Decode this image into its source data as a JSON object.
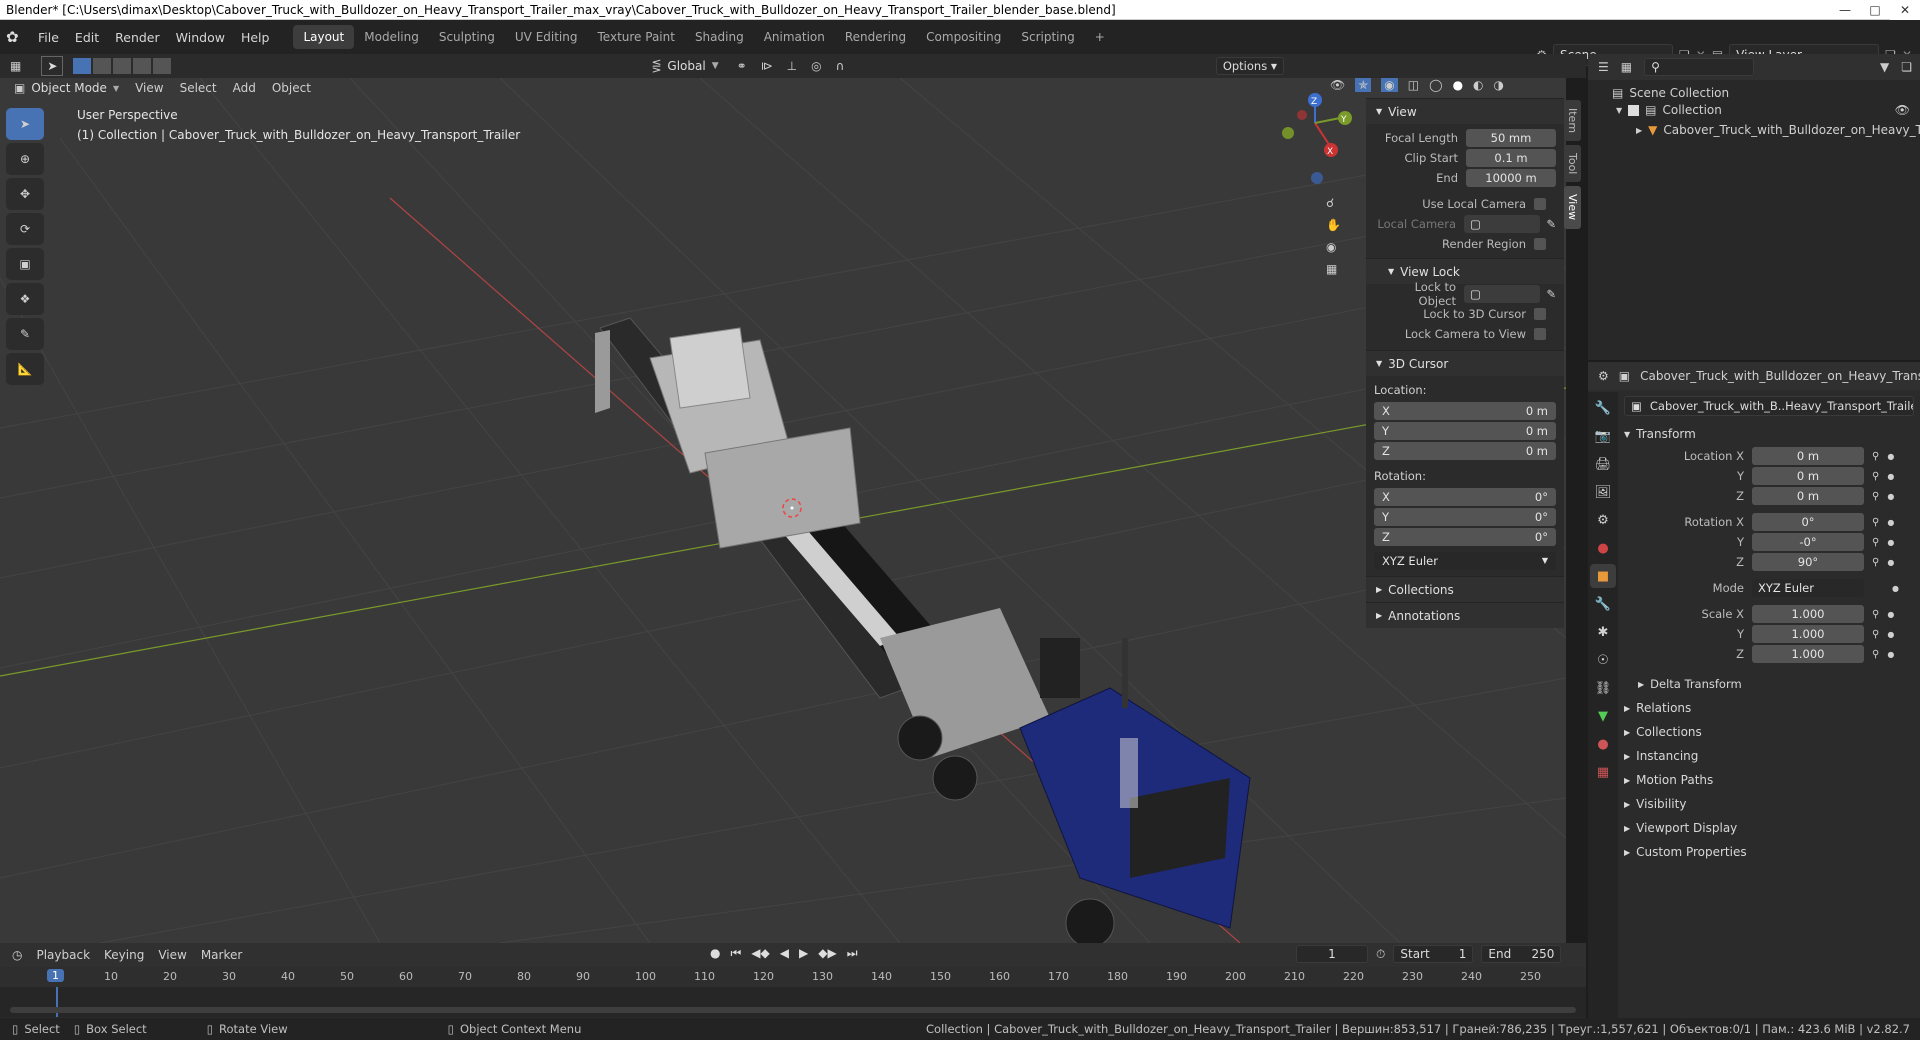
{
  "window": {
    "title": "Blender* [C:\\Users\\dimax\\Desktop\\Cabover_Truck_with_Bulldozer_on_Heavy_Transport_Trailer_max_vray\\Cabover_Truck_with_Bulldozer_on_Heavy_Transport_Trailer_blender_base.blend]"
  },
  "menu": [
    "File",
    "Edit",
    "Render",
    "Window",
    "Help"
  ],
  "workspaces": [
    "Layout",
    "Modeling",
    "Sculpting",
    "UV Editing",
    "Texture Paint",
    "Shading",
    "Animation",
    "Rendering",
    "Compositing",
    "Scripting"
  ],
  "scene": {
    "label": "Scene",
    "view_layer": "View Layer"
  },
  "viewport_header": {
    "mode": "Object Mode",
    "menus": [
      "View",
      "Select",
      "Add",
      "Object"
    ],
    "transform_orientation": "Global",
    "options": "Options"
  },
  "viewport": {
    "perspective": "User Perspective",
    "collection_info": "(1) Collection | Cabover_Truck_with_Bulldozer_on_Heavy_Transport_Trailer",
    "axes": {
      "x": "X",
      "y": "Y",
      "z": "Z"
    }
  },
  "npanel": {
    "tabs": [
      "Item",
      "Tool",
      "View"
    ],
    "view": {
      "header": "View",
      "focal_length_label": "Focal Length",
      "focal_length": "50 mm",
      "clip_start_label": "Clip Start",
      "clip_start": "0.1 m",
      "end_label": "End",
      "end": "10000 m",
      "use_local_camera": "Use Local Camera",
      "local_camera": "Local Camera",
      "render_region": "Render Region"
    },
    "view_lock": {
      "header": "View Lock",
      "lock_to_object": "Lock to Object",
      "lock_to_cursor": "Lock to 3D Cursor",
      "lock_camera": "Lock Camera to View"
    },
    "cursor": {
      "header": "3D Cursor",
      "location_label": "Location:",
      "rotation_label": "Rotation:",
      "loc": [
        {
          "axis": "X",
          "value": "0 m"
        },
        {
          "axis": "Y",
          "value": "0 m"
        },
        {
          "axis": "Z",
          "value": "0 m"
        }
      ],
      "rot": [
        {
          "axis": "X",
          "value": "0°"
        },
        {
          "axis": "Y",
          "value": "0°"
        },
        {
          "axis": "Z",
          "value": "0°"
        }
      ],
      "mode": "XYZ Euler"
    },
    "collections": "Collections",
    "annotations": "Annotations"
  },
  "outliner": {
    "scene_collection": "Scene Collection",
    "collection": "Collection",
    "object": "Cabover_Truck_with_Bulldozer_on_Heavy_Ti"
  },
  "properties": {
    "header_object": "Cabover_Truck_with_Bulldozer_on_Heavy_Transpor",
    "object_name": "Cabover_Truck_with_B..Heavy_Transport_Trailer",
    "transform_header": "Transform",
    "location": [
      {
        "label": "Location X",
        "value": "0 m"
      },
      {
        "label": "Y",
        "value": "0 m"
      },
      {
        "label": "Z",
        "value": "0 m"
      }
    ],
    "rotation": [
      {
        "label": "Rotation X",
        "value": "0°"
      },
      {
        "label": "Y",
        "value": "-0°"
      },
      {
        "label": "Z",
        "value": "90°"
      }
    ],
    "mode_label": "Mode",
    "mode": "XYZ Euler",
    "scale": [
      {
        "label": "Scale X",
        "value": "1.000"
      },
      {
        "label": "Y",
        "value": "1.000"
      },
      {
        "label": "Z",
        "value": "1.000"
      }
    ],
    "delta": "Delta Transform",
    "sections": [
      "Relations",
      "Collections",
      "Instancing",
      "Motion Paths",
      "Visibility",
      "Viewport Display",
      "Custom Properties"
    ]
  },
  "timeline": {
    "menus": [
      "Playback",
      "Keying",
      "View",
      "Marker"
    ],
    "current_frame": "1",
    "start_label": "Start",
    "start": "1",
    "end_label": "End",
    "end": "250",
    "ticks": [
      "10",
      "20",
      "30",
      "40",
      "50",
      "60",
      "70",
      "80",
      "90",
      "100",
      "110",
      "120",
      "130",
      "140",
      "150",
      "160",
      "170",
      "180",
      "190",
      "200",
      "210",
      "220",
      "230",
      "240",
      "250"
    ],
    "frame_indicator": "1"
  },
  "statusbar": {
    "select": "Select",
    "box_select": "Box Select",
    "rotate_view": "Rotate View",
    "context_menu": "Object Context Menu",
    "stats": "Collection | Cabover_Truck_with_Bulldozer_on_Heavy_Transport_Trailer | Вершин:853,517 | Граней:786,235 | Треуг.:1,557,621 | Объектов:0/1 | Пам.: 423.6 MiB | v2.82.7"
  },
  "colors": {
    "accent": "#4772b3",
    "grid": "#454545",
    "x_axis": "#b04444",
    "y_axis": "#7a9a2a",
    "truck_cab": "#1e2a7a"
  }
}
